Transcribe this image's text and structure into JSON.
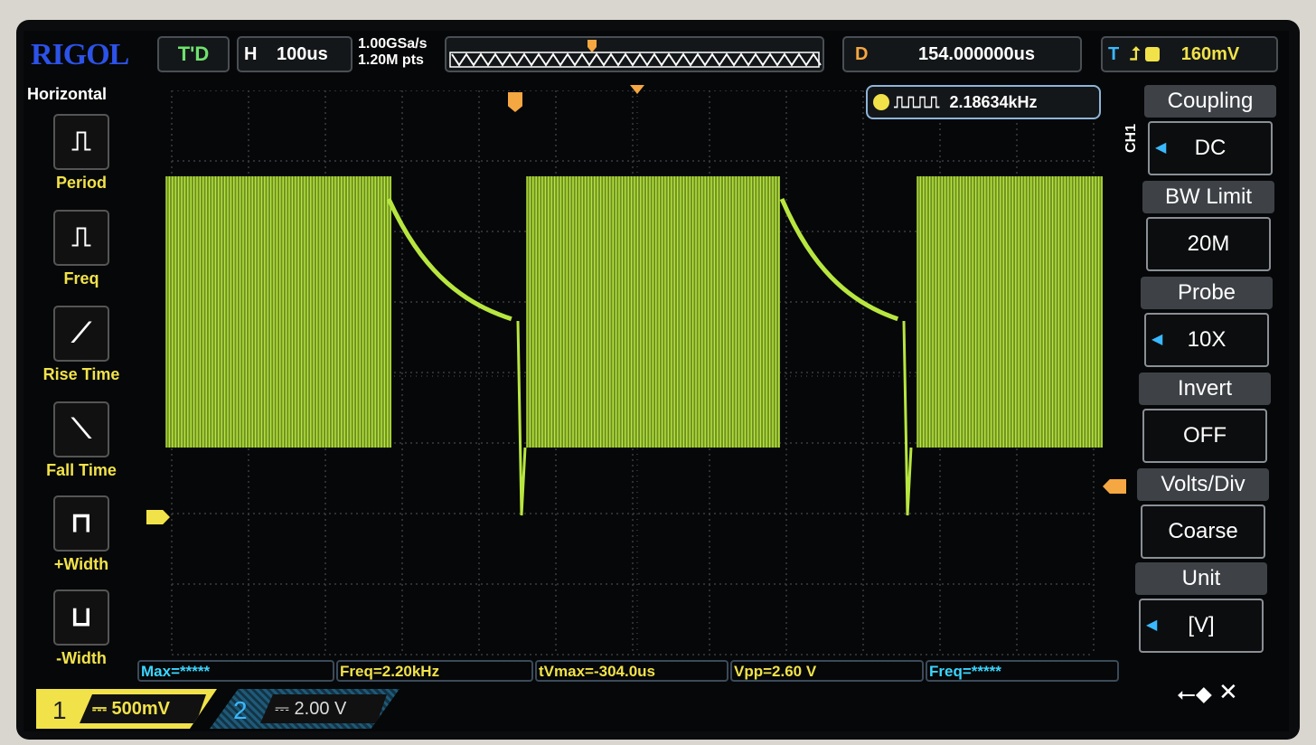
{
  "brand": "RIGOL",
  "status": {
    "run_state": "T'D",
    "horizontal_label": "H",
    "timebase": "100us",
    "sample_rate": "1.00GSa/s",
    "memory_depth": "1.20M pts",
    "delay_label": "D",
    "delay": "154.000000us",
    "trigger_label": "T",
    "trigger_level": "160mV"
  },
  "frequency_counter": "2.18634kHz",
  "left_menu": {
    "title": "Horizontal",
    "items": [
      {
        "label": "Period",
        "icon": "period-icon"
      },
      {
        "label": "Freq",
        "icon": "freq-icon"
      },
      {
        "label": "Rise Time",
        "icon": "rise-time-icon"
      },
      {
        "label": "Fall Time",
        "icon": "fall-time-icon"
      },
      {
        "label": "+Width",
        "icon": "pos-width-icon"
      },
      {
        "label": "-Width",
        "icon": "neg-width-icon"
      }
    ]
  },
  "right_menu": {
    "channel": "CH1",
    "items": [
      {
        "title": "Coupling",
        "value": "DC"
      },
      {
        "title": "BW Limit",
        "value": "20M"
      },
      {
        "title": "Probe",
        "value": "10X"
      },
      {
        "title": "Invert",
        "value": "OFF"
      },
      {
        "title": "Volts/Div",
        "value": "Coarse"
      },
      {
        "title": "Unit",
        "value": "[V]"
      }
    ]
  },
  "measurements": [
    "Max=*****",
    "Freq=2.20kHz",
    "tVmax=-304.0us",
    "Vpp=2.60 V",
    "Freq=*****"
  ],
  "channels": [
    {
      "num": "1",
      "scale": "500mV"
    },
    {
      "num": "2",
      "scale": "2.00 V"
    }
  ],
  "colors": {
    "ch1": "#b8e640",
    "ch2": "#3ab8ff",
    "accent": "#f1e24a",
    "trigger": "#f5a742"
  }
}
